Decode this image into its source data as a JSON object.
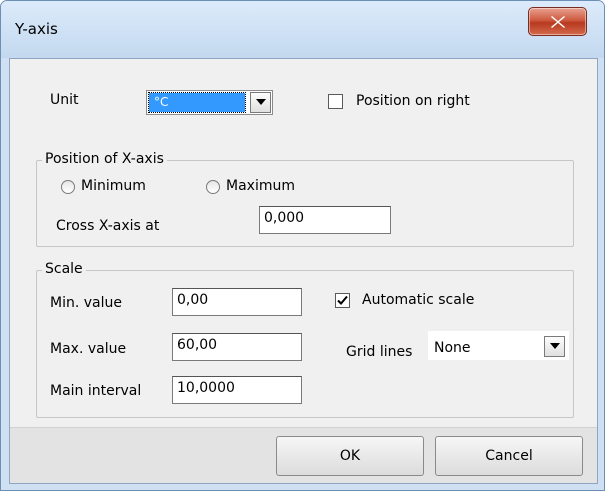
{
  "window": {
    "title": "Y-axis"
  },
  "unit": {
    "label": "Unit",
    "selected": "°C",
    "position_on_right": {
      "label": "Position on right",
      "checked": false
    }
  },
  "x_axis_position": {
    "group_title": "Position of X-axis",
    "options": [
      {
        "label": "Minimum",
        "selected": false
      },
      {
        "label": "Maximum",
        "selected": false
      }
    ],
    "cross_label": "Cross X-axis at",
    "cross_value": "0,000"
  },
  "scale": {
    "group_title": "Scale",
    "min_label": "Min. value",
    "min_value": "0,00",
    "max_label": "Max. value",
    "max_value": "60,00",
    "interval_label": "Main interval",
    "interval_value": "10,0000",
    "automatic": {
      "label": "Automatic scale",
      "checked": true
    },
    "grid_label": "Grid lines",
    "grid_value": "None"
  },
  "buttons": {
    "ok": "OK",
    "cancel": "Cancel"
  },
  "icons": {
    "close": "close-icon",
    "dropdown": "chevron-down-icon",
    "check": "checkmark-icon"
  }
}
